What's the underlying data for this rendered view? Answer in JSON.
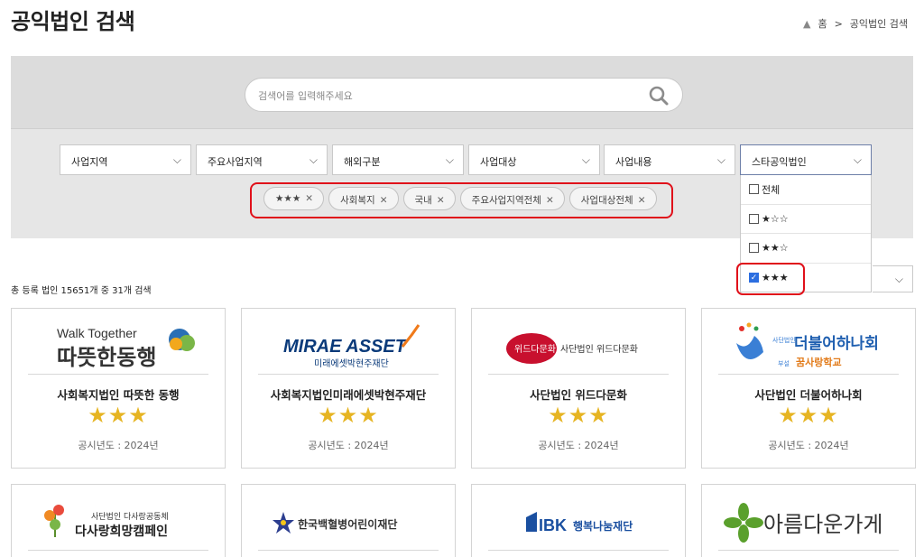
{
  "header": {
    "title": "공익법인 검색"
  },
  "breadcrumb": {
    "home": "홈",
    "sep": ">",
    "current": "공익법인 검색"
  },
  "search": {
    "placeholder": "검색어를 입력해주세요"
  },
  "filters": [
    {
      "label": "사업지역"
    },
    {
      "label": "주요사업지역"
    },
    {
      "label": "해외구분"
    },
    {
      "label": "사업대상"
    },
    {
      "label": "사업내용"
    },
    {
      "label": "스타공익법인"
    }
  ],
  "tags": [
    "★★★",
    "사회복지",
    "국내",
    "주요사업지역전체",
    "사업대상전체"
  ],
  "star_dropdown": {
    "options": [
      {
        "label": "전체",
        "checked": false
      },
      {
        "label": "★☆☆",
        "checked": false
      },
      {
        "label": "★★☆",
        "checked": false
      },
      {
        "label": "★★★",
        "checked": true
      }
    ]
  },
  "result": {
    "summary": "총 등록 법인 15651개 중 31개 검색"
  },
  "cards": [
    {
      "logo_line1": "Walk Together",
      "logo_line2": "따뜻한동행",
      "name": "사회복지법인 따뜻한 동행",
      "stars": "★★★",
      "year": "공시년도 : 2024년"
    },
    {
      "logo_line1": "MIRAE ASSET",
      "logo_line2": "미래에셋박현주재단",
      "name": "사회복지법인미래에셋박현주재단",
      "stars": "★★★",
      "year": "공시년도 : 2024년"
    },
    {
      "logo_line1": "위드다문화",
      "logo_line2": "사단법인 위드다문화",
      "name": "사단법인 위드다문화",
      "stars": "★★★",
      "year": "공시년도 : 2024년"
    },
    {
      "logo_line1": "더불어하나회",
      "logo_line2": "꿈사랑학교",
      "logo_small1": "사단법인",
      "logo_small2": "부설",
      "name": "사단법인 더불어하나회",
      "stars": "★★★",
      "year": "공시년도 : 2024년"
    },
    {
      "logo_line1": "사단법인 다사랑공동체",
      "logo_line2": "다사랑희망캠페인"
    },
    {
      "logo_line1": "한국백혈병어린이재단"
    },
    {
      "logo_line1": "IBK",
      "logo_line2": "행복나눔재단"
    },
    {
      "logo_line1": "아름다운가게"
    }
  ],
  "colors": {
    "accent_red": "#e0101a",
    "star_gold": "#e6b422",
    "search_bg": "#dcdcdc",
    "filter_bg": "#e6e6e6"
  }
}
